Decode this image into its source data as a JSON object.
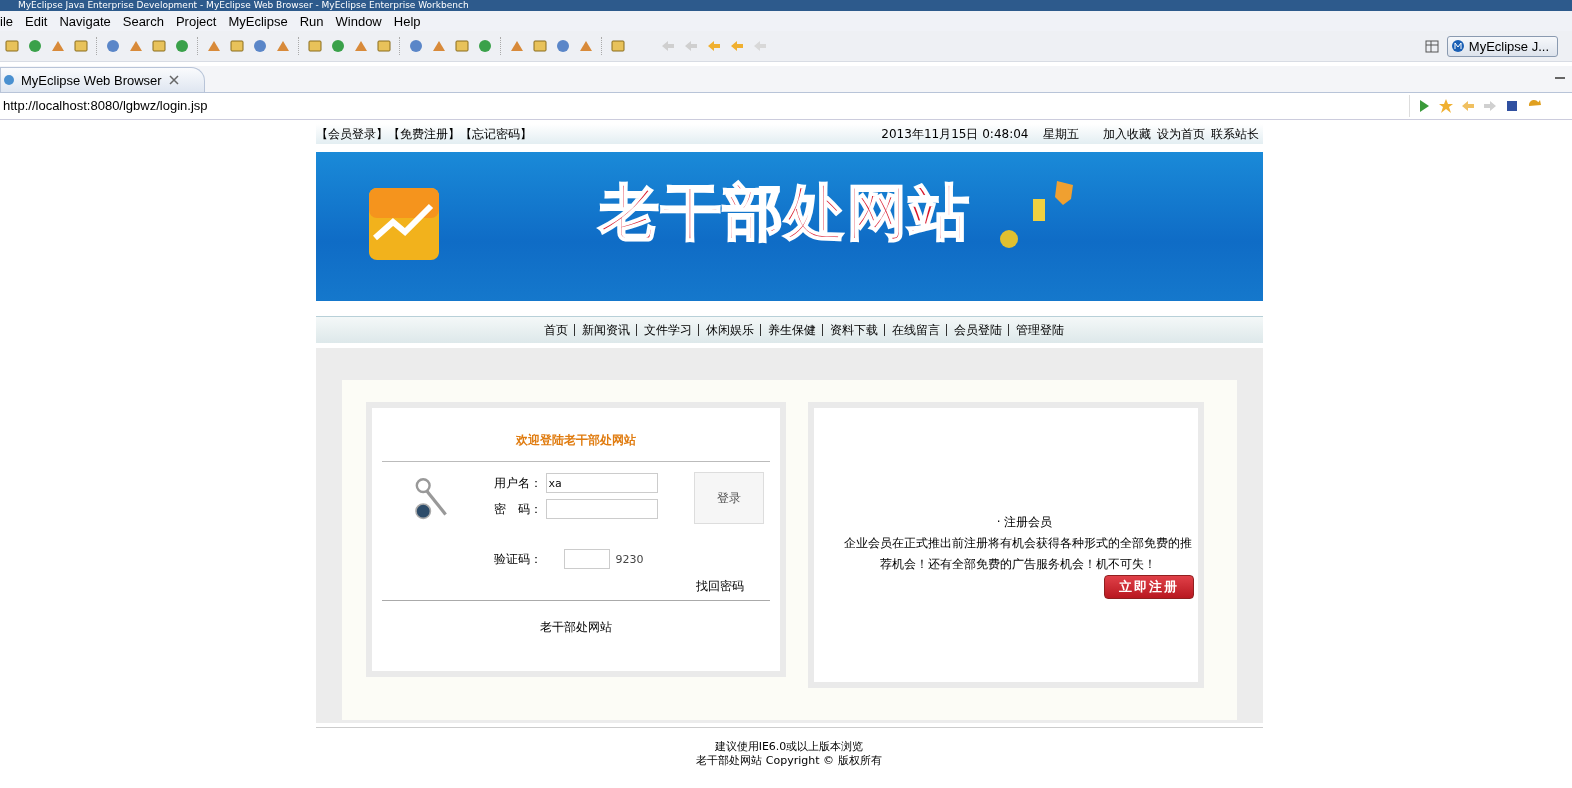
{
  "window": {
    "title": "MyEclipse Java Enterprise Development - MyEclipse Web Browser - MyEclipse Enterprise Workbench"
  },
  "menu": [
    "ile",
    "Edit",
    "Navigate",
    "Search",
    "Project",
    "MyEclipse",
    "Run",
    "Window",
    "Help"
  ],
  "perspective": "MyEclipse J...",
  "editor_tab": {
    "label": "MyEclipse Web Browser",
    "selected": true
  },
  "address": "http://localhost:8080/lgbwz/login.jsp",
  "page": {
    "top_links": [
      "【会员登录】",
      "【免费注册】",
      "【忘记密码】"
    ],
    "date": "2013年11月15日 0:48:04",
    "weekday": "星期五",
    "right_links": [
      "加入收藏",
      "设为首页",
      "联系站长"
    ],
    "site_title": "老干部处网站",
    "nav": [
      "首页",
      "新闻资讯",
      "文件学习",
      "休闲娱乐",
      "养生保健",
      "资料下载",
      "在线留言",
      "会员登陆",
      "管理登陆"
    ],
    "login": {
      "heading": "欢迎登陆老干部处网站",
      "username_label": "用户名：",
      "username": "xa",
      "password_label": "密　码：",
      "captcha_label": "验证码：",
      "captcha_code": "9230",
      "login_button": "登录",
      "recover_link": "找回密码",
      "footer": "老干部处网站"
    },
    "register": {
      "heading": "· 注册会员",
      "text": "企业会员在正式推出前注册将有机会获得各种形式的全部免费的推荐机会！还有全部免费的广告服务机会！机不可失！",
      "button": "立即注册"
    },
    "footer": [
      "建议使用IE6.0或以上版本浏览",
      "老干部处网站 Copyright © 版权所有"
    ]
  }
}
